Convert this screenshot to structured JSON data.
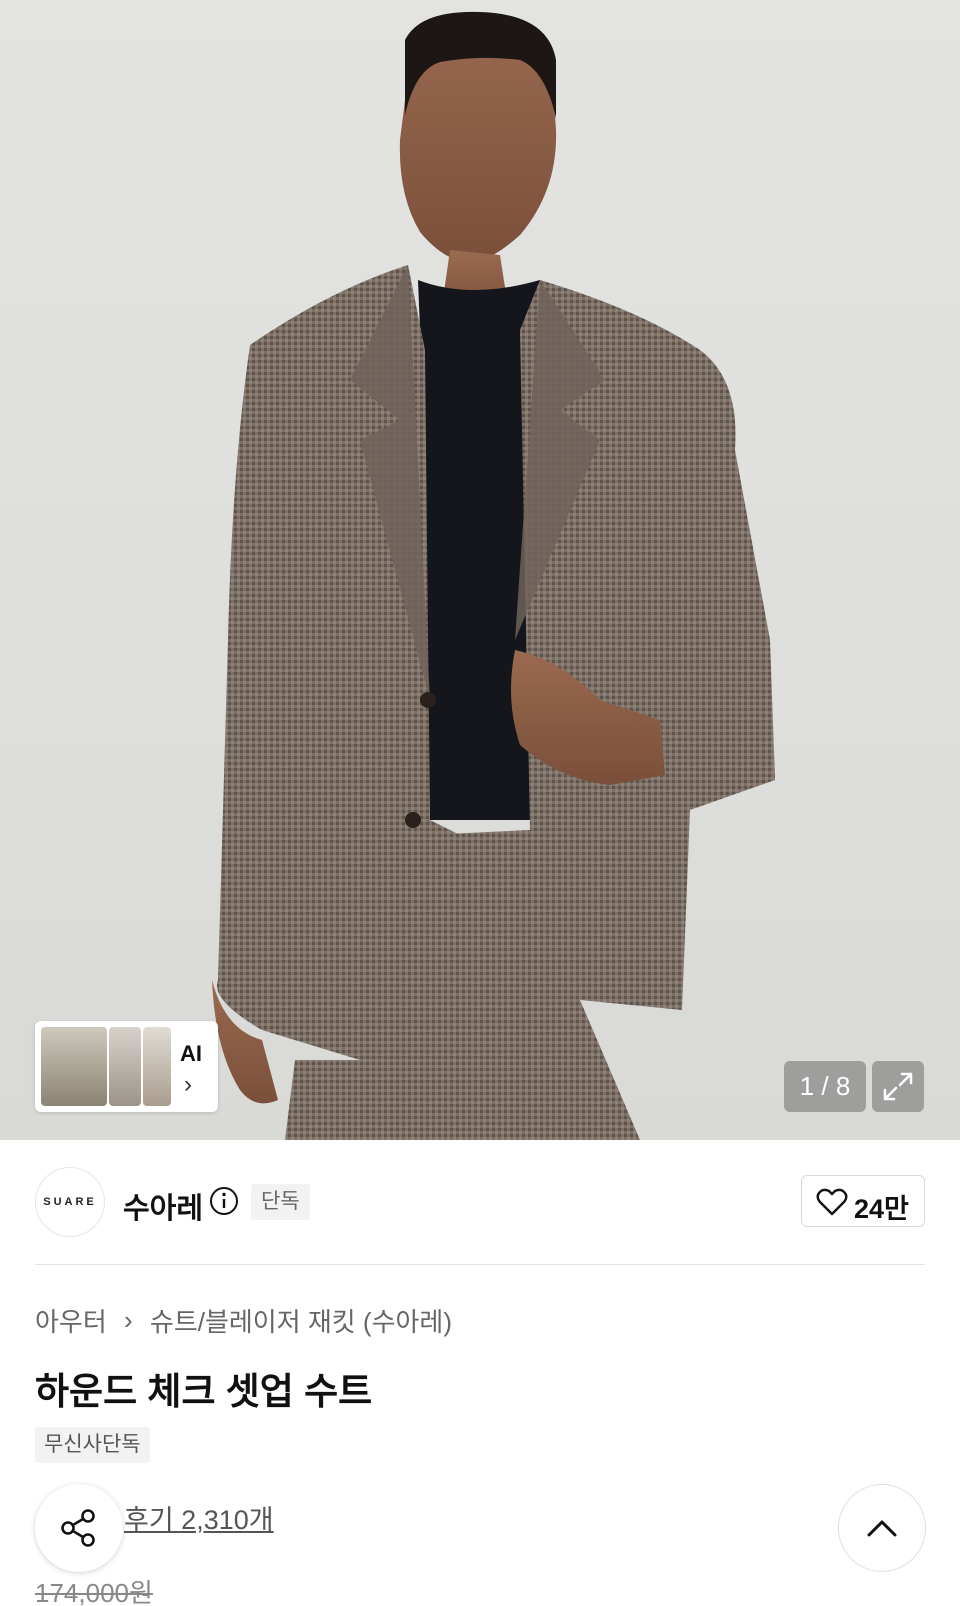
{
  "gallery": {
    "pager": "1 / 8",
    "ai_label": "AI",
    "expand_icon": "expand-icon"
  },
  "brand": {
    "logo_text": "SUARE",
    "name": "수아레",
    "badge": "단독",
    "like_count": "24만"
  },
  "product": {
    "breadcrumb": [
      "아우터",
      "슈트/블레이저 재킷 (수아레)"
    ],
    "title": "하운드 체크 셋업 수트",
    "tag": "무신사단독",
    "reviews": "후기 2,310개",
    "original_price": "174,000원"
  },
  "colors": {
    "accent": "#111111",
    "badge_bg": "#f2f2f2"
  }
}
